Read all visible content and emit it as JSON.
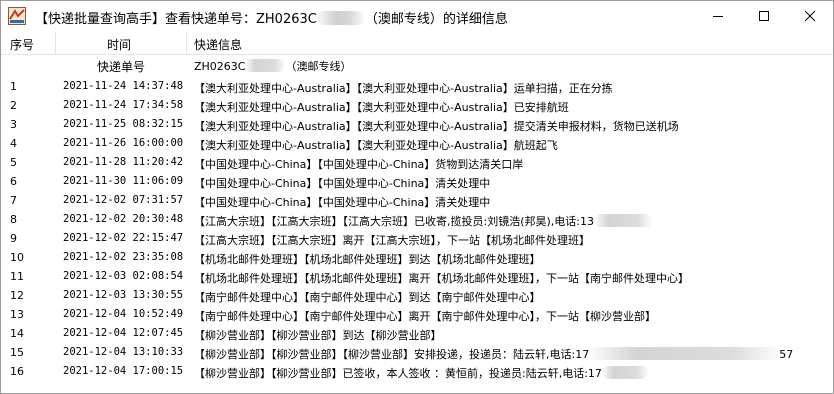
{
  "window": {
    "title_prefix": "【快递批量查询高手】查看快递单号：ZH0263C",
    "title_suffix": "（澳邮专线）的详细信息",
    "minimize_icon": "minimize-icon",
    "maximize_icon": "maximize-icon",
    "close_icon": "close-icon"
  },
  "columns": {
    "index": "序号",
    "time": "时间",
    "info": "快递信息",
    "tracking_label": "快递单号",
    "tracking_value": "ZH0263C",
    "tracking_suffix": "（澳邮专线）"
  },
  "rows": [
    {
      "idx": "1",
      "time": "2021-11-24 14:37:48",
      "info": "【澳大利亚处理中心-Australia】【澳大利亚处理中心-Australia】运单扫描，正在分拣"
    },
    {
      "idx": "2",
      "time": "2021-11-24 17:34:58",
      "info": "【澳大利亚处理中心-Australia】【澳大利亚处理中心-Australia】已安排航班"
    },
    {
      "idx": "3",
      "time": "2021-11-25 08:32:15",
      "info": "【澳大利亚处理中心-Australia】【澳大利亚处理中心-Australia】提交清关申报材料，货物已送机场"
    },
    {
      "idx": "4",
      "time": "2021-11-26 16:00:00",
      "info": "【澳大利亚处理中心-Australia】【澳大利亚处理中心-Australia】航班起飞"
    },
    {
      "idx": "5",
      "time": "2021-11-28 11:20:42",
      "info": "【中国处理中心-China】【中国处理中心-China】货物到达清关口岸"
    },
    {
      "idx": "6",
      "time": "2021-11-30 11:06:09",
      "info": "【中国处理中心-China】【中国处理中心-China】清关处理中"
    },
    {
      "idx": "7",
      "time": "2021-12-02 07:31:57",
      "info": "【中国处理中心-China】【中国处理中心-China】清关处理中"
    },
    {
      "idx": "8",
      "time": "2021-12-02 20:30:48",
      "info": "【江高大宗班】【江高大宗班】【江高大宗班】已收寄,揽投员:刘镜浩(邦昊),电话:13"
    },
    {
      "idx": "9",
      "time": "2021-12-02 22:15:47",
      "info": "【江高大宗班】【江高大宗班】离开【江高大宗班】，下一站【机场北邮件处理班】"
    },
    {
      "idx": "10",
      "time": "2021-12-02 23:35:08",
      "info": "【机场北邮件处理班】【机场北邮件处理班】到达【机场北邮件处理班】"
    },
    {
      "idx": "11",
      "time": "2021-12-03 02:08:54",
      "info": "【机场北邮件处理班】【机场北邮件处理班】离开【机场北邮件处理班】，下一站【南宁邮件处理中心】"
    },
    {
      "idx": "12",
      "time": "2021-12-03 13:30:55",
      "info": "【南宁邮件处理中心】【南宁邮件处理中心】到达【南宁邮件处理中心】"
    },
    {
      "idx": "13",
      "time": "2021-12-04 10:52:49",
      "info": "【南宁邮件处理中心】【南宁邮件处理中心】离开【南宁邮件处理中心】，下一站【柳沙营业部】"
    },
    {
      "idx": "14",
      "time": "2021-12-04 12:07:45",
      "info": "【柳沙营业部】【柳沙营业部】到达【柳沙营业部】"
    },
    {
      "idx": "15",
      "time": "2021-12-04 13:10:33",
      "info": "【柳沙营业部】【柳沙营业部】【柳沙营业部】安排投递，投递员：陆云轩,电话:17",
      "tail": "57"
    },
    {
      "idx": "16",
      "time": "2021-12-04 17:00:15",
      "info": "【柳沙营业部】【柳沙营业部】已签收，本人签收 ：黄恒前，投递员:陆云轩,电话:17"
    }
  ]
}
